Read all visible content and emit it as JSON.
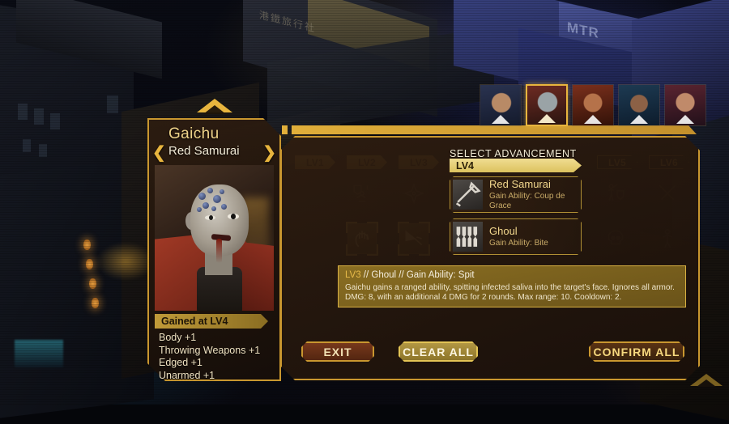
{
  "character": {
    "name": "Gaichu",
    "title": "Red Samurai",
    "prev_arrow": "❮",
    "next_arrow": "❯",
    "gained_label": "Gained at LV4",
    "stats": [
      "Body +1",
      "Throwing Weapons +1",
      "Edged +1",
      "Unarmed +1"
    ]
  },
  "roster": [
    {
      "name": "portrait-1",
      "selected": false
    },
    {
      "name": "portrait-2-gaichu",
      "selected": true
    },
    {
      "name": "portrait-3",
      "selected": false
    },
    {
      "name": "portrait-4",
      "selected": false
    },
    {
      "name": "portrait-5",
      "selected": false
    }
  ],
  "levels": [
    {
      "label": "LV1",
      "state": "unlocked"
    },
    {
      "label": "LV2",
      "state": "unlocked"
    },
    {
      "label": "LV3",
      "state": "unlocked"
    },
    {
      "label": "LV5",
      "state": "locked"
    },
    {
      "label": "LV6",
      "state": "locked"
    }
  ],
  "advancement": {
    "header": "SELECT ADVANCEMENT",
    "level": "LV4",
    "options": [
      {
        "name": "Red Samurai",
        "desc": "Gain Ability: Coup de Grace",
        "icon": "sword-icon"
      },
      {
        "name": "Ghoul",
        "desc": "Gain Ability: Bite",
        "icon": "teeth-icon"
      }
    ]
  },
  "description": {
    "level": "LV3",
    "sep": " // ",
    "branch": "Ghoul",
    "ability": "Gain Ability: Spit",
    "title_rest": " // Ghoul // Gain Ability: Spit",
    "body": "Gaichu gains a ranged ability, spitting infected saliva into the target's face. Ignores all armor. DMG: 8, with an additional 4 DMG for 2 rounds. Max range: 10. Cooldown: 2."
  },
  "buttons": {
    "exit": "EXIT",
    "clear_all": "CLEAR ALL",
    "confirm_all": "CONFIRM ALL"
  },
  "background": {
    "sign_mtr": "MTR",
    "sign_cjk": "港鐵旅行社"
  },
  "colors": {
    "gold": "#c9972f",
    "gold_light": "#e8b53e",
    "cream": "#f3ecd8",
    "panel_dark": "#2c1c10",
    "exit_red": "#7a3a1d"
  }
}
